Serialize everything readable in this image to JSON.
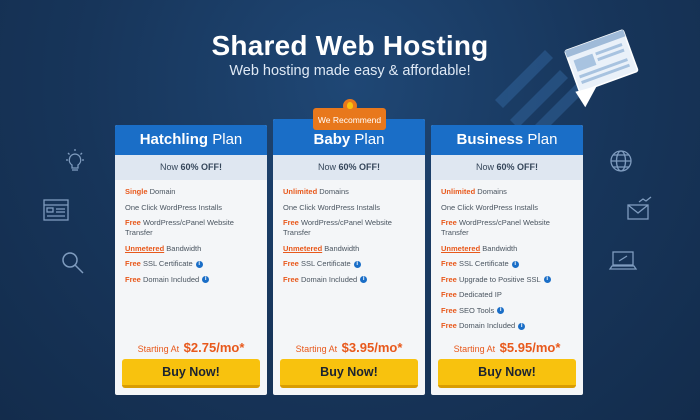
{
  "hero": {
    "title": "Shared Web Hosting",
    "subtitle": "Web hosting made easy & affordable!"
  },
  "badge": {
    "label": "We Recommend"
  },
  "plans": [
    {
      "name": "Hatchling",
      "name_suffix": "Plan",
      "discount_prefix": "Now",
      "discount": "60% OFF!",
      "features": [
        {
          "hl": "Single",
          "text": "Domain",
          "info": false
        },
        {
          "hl": "",
          "text": "One Click WordPress Installs",
          "info": false
        },
        {
          "hl": "Free",
          "text": "WordPress/cPanel Website Transfer",
          "info": false
        },
        {
          "hl": "Unmetered",
          "text": "Bandwidth",
          "info": false
        },
        {
          "hl": "Free",
          "text": "SSL Certificate",
          "info": true
        },
        {
          "hl": "Free",
          "text": "Domain Included",
          "info": true
        }
      ],
      "price_prefix": "Starting At",
      "price": "$2.75/mo*",
      "button": "Buy Now!"
    },
    {
      "name": "Baby",
      "name_suffix": "Plan",
      "discount_prefix": "Now",
      "discount": "60% OFF!",
      "features": [
        {
          "hl": "Unlimited",
          "text": "Domains",
          "info": false
        },
        {
          "hl": "",
          "text": "One Click WordPress Installs",
          "info": false
        },
        {
          "hl": "Free",
          "text": "WordPress/cPanel Website Transfer",
          "info": false
        },
        {
          "hl": "Unmetered",
          "text": "Bandwidth",
          "info": false
        },
        {
          "hl": "Free",
          "text": "SSL Certificate",
          "info": true
        },
        {
          "hl": "Free",
          "text": "Domain Included",
          "info": true
        }
      ],
      "price_prefix": "Starting At",
      "price": "$3.95/mo*",
      "button": "Buy Now!"
    },
    {
      "name": "Business",
      "name_suffix": "Plan",
      "discount_prefix": "Now",
      "discount": "60% OFF!",
      "features": [
        {
          "hl": "Unlimited",
          "text": "Domains",
          "info": false
        },
        {
          "hl": "",
          "text": "One Click WordPress Installs",
          "info": false
        },
        {
          "hl": "Free",
          "text": "WordPress/cPanel Website Transfer",
          "info": false
        },
        {
          "hl": "Unmetered",
          "text": "Bandwidth",
          "info": false
        },
        {
          "hl": "Free",
          "text": "SSL Certificate",
          "info": true
        },
        {
          "hl": "Free",
          "text": "Upgrade to Positive SSL",
          "info": true
        },
        {
          "hl": "Free",
          "text": "Dedicated IP",
          "info": false
        },
        {
          "hl": "Free",
          "text": "SEO Tools",
          "info": true
        },
        {
          "hl": "Free",
          "text": "Domain Included",
          "info": true
        }
      ],
      "price_prefix": "Starting At",
      "price": "$5.95/mo*",
      "button": "Buy Now!"
    }
  ],
  "decor_icons": [
    "lightbulb-icon",
    "browser-layout-icon",
    "magnifier-icon",
    "globe-icon",
    "mail-chart-icon",
    "laptop-icon",
    "rocket-browser-icon"
  ],
  "colors": {
    "background": "#17355a",
    "accent": "#e8591c",
    "header": "#1a6ec7",
    "button": "#f8c20e"
  }
}
